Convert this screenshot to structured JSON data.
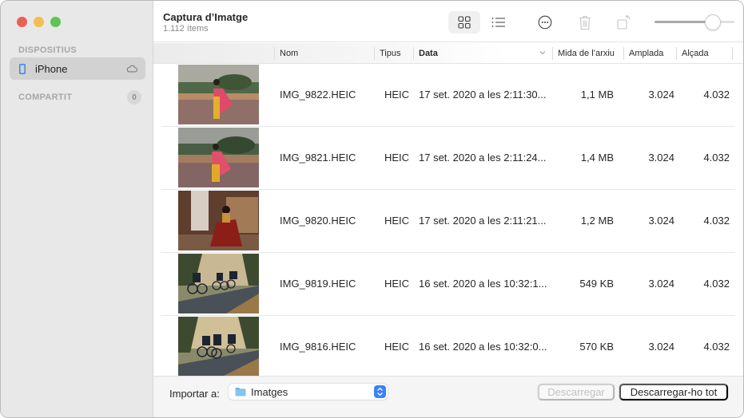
{
  "window": {
    "title": "Captura d’Imatge",
    "subtitle": "1.112 ítems"
  },
  "sidebar": {
    "devices_label": "DISPOSITIUS",
    "device": {
      "label": "iPhone",
      "icon": "iphone-icon",
      "status_icon": "cloud-icon"
    },
    "shared_label": "COMPARTIT",
    "shared_count": "0"
  },
  "toolbar": {
    "view_grid": {
      "icon": "grid-view-icon",
      "active": true
    },
    "view_list": {
      "icon": "list-view-icon",
      "active": false
    },
    "more": {
      "icon": "ellipsis-circle-icon"
    },
    "delete": {
      "icon": "trash-icon",
      "enabled": false
    },
    "rotate": {
      "icon": "rotate-left-icon",
      "enabled": false
    },
    "thumbnail_size_slider": {
      "value": 0.74
    }
  },
  "table": {
    "columns": [
      {
        "key": "name",
        "label": "Nom"
      },
      {
        "key": "type",
        "label": "Tipus"
      },
      {
        "key": "date",
        "label": "Data",
        "sorted": true,
        "sort_direction": "descending"
      },
      {
        "key": "size",
        "label": "Mida de l’arxiu"
      },
      {
        "key": "width",
        "label": "Amplada"
      },
      {
        "key": "height",
        "label": "Alçada"
      }
    ],
    "rows": [
      {
        "name": "IMG_9822.HEIC",
        "type": "HEIC",
        "date": "17 set. 2020 a les 2:11:30...",
        "size": "1,1 MB",
        "width": "3.024",
        "height": "4.032",
        "thumb": "woman-in-sari-garden"
      },
      {
        "name": "IMG_9821.HEIC",
        "type": "HEIC",
        "date": "17 set. 2020 a les 2:11:24...",
        "size": "1,4 MB",
        "width": "3.024",
        "height": "4.032",
        "thumb": "woman-in-sari-garden-2"
      },
      {
        "name": "IMG_9820.HEIC",
        "type": "HEIC",
        "date": "17 set. 2020 a les 2:11:21...",
        "size": "1,2 MB",
        "width": "3.024",
        "height": "4.032",
        "thumb": "woman-by-lattice-window"
      },
      {
        "name": "IMG_9819.HEIC",
        "type": "HEIC",
        "date": "16 set. 2020 a les 10:32:1...",
        "size": "549 KB",
        "width": "3.024",
        "height": "4.032",
        "thumb": "cyclists-on-road"
      },
      {
        "name": "IMG_9816.HEIC",
        "type": "HEIC",
        "date": "16 set. 2020 a les 10:32:0...",
        "size": "570 KB",
        "width": "3.024",
        "height": "4.032",
        "thumb": "cyclists-on-road-2"
      }
    ]
  },
  "footer": {
    "import_label": "Importar a:",
    "import_destination": "Imatges",
    "download_label": "Descarregar",
    "download_all_label": "Descarregar-ho tot"
  },
  "colors": {
    "accent": "#3a82f7",
    "close": "#ec5f57",
    "minimize": "#f4be4f",
    "maximize": "#5fc454"
  }
}
